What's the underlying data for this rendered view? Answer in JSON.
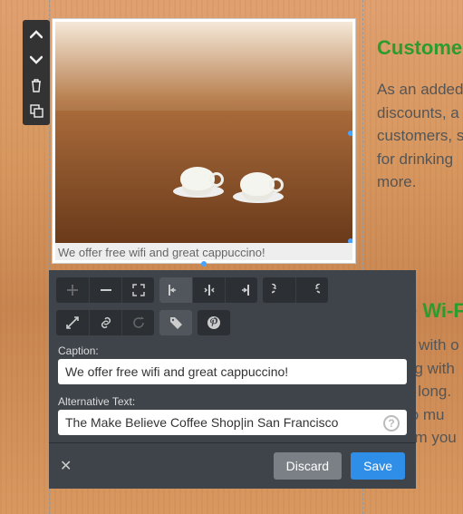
{
  "background": {
    "heading1": "Custome",
    "paragraph1": "As an added\ndiscounts, a\ncustomers, s\nfor drinking\nmore.",
    "heading2": "e Wi-F",
    "paragraph2": "g with o\nng with\ny long.\nto mu\nom you"
  },
  "leftToolbar": {
    "items": [
      {
        "name": "move-up",
        "icon": "chevron-up"
      },
      {
        "name": "move-down",
        "icon": "chevron-down"
      },
      {
        "name": "delete",
        "icon": "trash"
      },
      {
        "name": "duplicate",
        "icon": "copy"
      }
    ]
  },
  "imageBlock": {
    "caption": "We offer free wifi and great cappuccino!"
  },
  "editor": {
    "row1": {
      "group1": [
        {
          "name": "add",
          "icon": "plus",
          "disabled": true
        },
        {
          "name": "remove",
          "icon": "minus"
        },
        {
          "name": "expand",
          "icon": "arrows-out"
        }
      ],
      "group2": [
        {
          "name": "align-left",
          "icon": "align-l",
          "active": true
        },
        {
          "name": "align-center",
          "icon": "align-c"
        },
        {
          "name": "align-right",
          "icon": "align-r"
        }
      ],
      "group3": [
        {
          "name": "undo",
          "icon": "undo"
        },
        {
          "name": "redo",
          "icon": "redo"
        }
      ]
    },
    "row2": {
      "group1": [
        {
          "name": "fullscreen",
          "icon": "diag-arrows"
        },
        {
          "name": "link",
          "icon": "link"
        },
        {
          "name": "reload",
          "icon": "refresh",
          "disabled": true
        }
      ],
      "group2": [
        {
          "name": "tag",
          "icon": "tag",
          "active": true
        }
      ],
      "group3": [
        {
          "name": "pinterest",
          "icon": "pinterest"
        }
      ]
    },
    "captionLabel": "Caption:",
    "captionValue": "We offer free wifi and great cappuccino!",
    "altLabel": "Alternative Text:",
    "altValue": "The Make Believe Coffee Shop|in San Francisco",
    "discard": "Discard",
    "save": "Save"
  }
}
